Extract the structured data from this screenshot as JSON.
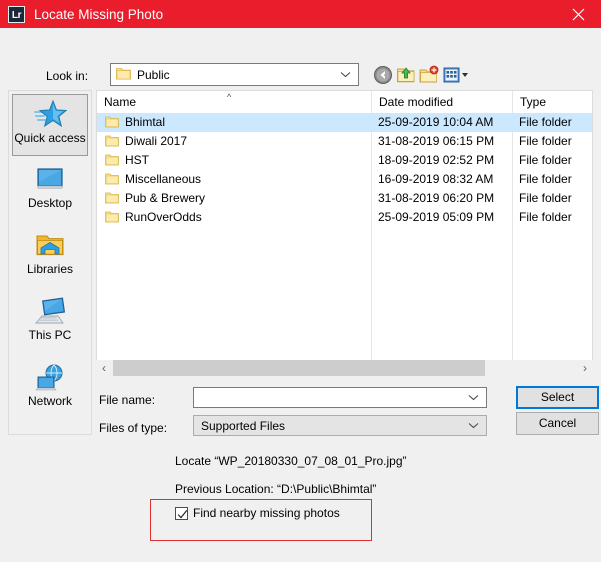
{
  "window": {
    "title": "Locate Missing Photo",
    "logo_text": "Lr",
    "close_icon": "close-icon",
    "titlebar_color": "#ea1d2c"
  },
  "toolbar": {
    "lookin_label": "Look in:",
    "lookin_value": "Public",
    "icons": [
      {
        "name": "back-icon",
        "label": "Back"
      },
      {
        "name": "up-folder-icon",
        "label": "Up one level"
      },
      {
        "name": "new-folder-icon",
        "label": "Create New Folder"
      },
      {
        "name": "views-icon",
        "label": "Views"
      }
    ]
  },
  "places": {
    "items": [
      {
        "label": "Quick access",
        "icon": "star-icon",
        "selected": true
      },
      {
        "label": "Desktop",
        "icon": "monitor-icon",
        "selected": false
      },
      {
        "label": "Libraries",
        "icon": "libraries-folder-icon",
        "selected": false
      },
      {
        "label": "This PC",
        "icon": "computer-icon",
        "selected": false
      },
      {
        "label": "Network",
        "icon": "network-globe-icon",
        "selected": false
      }
    ]
  },
  "filelist": {
    "columns": [
      "Name",
      "Date modified",
      "Type"
    ],
    "sort_column": "Name",
    "sort_direction": "ascending",
    "selection_color": "#cce8ff",
    "rows": [
      {
        "name": "Bhimtal",
        "date": "25-09-2019 10:04 AM",
        "type": "File folder",
        "selected": true
      },
      {
        "name": "Diwali 2017",
        "date": "31-08-2019 06:15 PM",
        "type": "File folder",
        "selected": false
      },
      {
        "name": "HST",
        "date": "18-09-2019 02:52 PM",
        "type": "File folder",
        "selected": false
      },
      {
        "name": "Miscellaneous",
        "date": "16-09-2019 08:32 AM",
        "type": "File folder",
        "selected": false
      },
      {
        "name": "Pub & Brewery",
        "date": "31-08-2019 06:20 PM",
        "type": "File folder",
        "selected": false
      },
      {
        "name": "RunOverOdds",
        "date": "25-09-2019 05:09 PM",
        "type": "File folder",
        "selected": false
      }
    ]
  },
  "scrollbar": {
    "left_arrow": "‹",
    "right_arrow": "›"
  },
  "form": {
    "filename_label": "File name:",
    "filename_value": "",
    "filetype_label": "Files of type:",
    "filetype_value": "Supported Files",
    "select_button": "Select",
    "cancel_button": "Cancel"
  },
  "messages": {
    "locate": "Locate “WP_20180330_07_08_01_Pro.jpg”",
    "previous_location": "Previous Location: “D:\\Public\\Bhimtal”",
    "checkbox_label": "Find nearby missing photos",
    "checkbox_checked": true,
    "highlight_color": "#e03030"
  }
}
